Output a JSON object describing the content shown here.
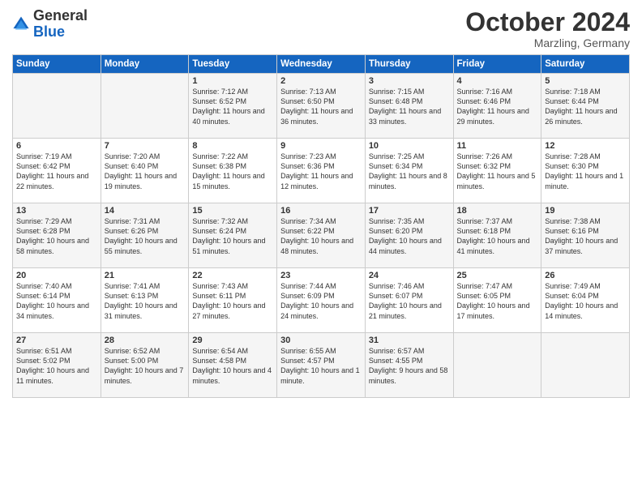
{
  "header": {
    "logo_general": "General",
    "logo_blue": "Blue",
    "month_title": "October 2024",
    "location": "Marzling, Germany"
  },
  "days_of_week": [
    "Sunday",
    "Monday",
    "Tuesday",
    "Wednesday",
    "Thursday",
    "Friday",
    "Saturday"
  ],
  "weeks": [
    [
      {
        "num": "",
        "info": ""
      },
      {
        "num": "",
        "info": ""
      },
      {
        "num": "1",
        "info": "Sunrise: 7:12 AM\nSunset: 6:52 PM\nDaylight: 11 hours and 40 minutes."
      },
      {
        "num": "2",
        "info": "Sunrise: 7:13 AM\nSunset: 6:50 PM\nDaylight: 11 hours and 36 minutes."
      },
      {
        "num": "3",
        "info": "Sunrise: 7:15 AM\nSunset: 6:48 PM\nDaylight: 11 hours and 33 minutes."
      },
      {
        "num": "4",
        "info": "Sunrise: 7:16 AM\nSunset: 6:46 PM\nDaylight: 11 hours and 29 minutes."
      },
      {
        "num": "5",
        "info": "Sunrise: 7:18 AM\nSunset: 6:44 PM\nDaylight: 11 hours and 26 minutes."
      }
    ],
    [
      {
        "num": "6",
        "info": "Sunrise: 7:19 AM\nSunset: 6:42 PM\nDaylight: 11 hours and 22 minutes."
      },
      {
        "num": "7",
        "info": "Sunrise: 7:20 AM\nSunset: 6:40 PM\nDaylight: 11 hours and 19 minutes."
      },
      {
        "num": "8",
        "info": "Sunrise: 7:22 AM\nSunset: 6:38 PM\nDaylight: 11 hours and 15 minutes."
      },
      {
        "num": "9",
        "info": "Sunrise: 7:23 AM\nSunset: 6:36 PM\nDaylight: 11 hours and 12 minutes."
      },
      {
        "num": "10",
        "info": "Sunrise: 7:25 AM\nSunset: 6:34 PM\nDaylight: 11 hours and 8 minutes."
      },
      {
        "num": "11",
        "info": "Sunrise: 7:26 AM\nSunset: 6:32 PM\nDaylight: 11 hours and 5 minutes."
      },
      {
        "num": "12",
        "info": "Sunrise: 7:28 AM\nSunset: 6:30 PM\nDaylight: 11 hours and 1 minute."
      }
    ],
    [
      {
        "num": "13",
        "info": "Sunrise: 7:29 AM\nSunset: 6:28 PM\nDaylight: 10 hours and 58 minutes."
      },
      {
        "num": "14",
        "info": "Sunrise: 7:31 AM\nSunset: 6:26 PM\nDaylight: 10 hours and 55 minutes."
      },
      {
        "num": "15",
        "info": "Sunrise: 7:32 AM\nSunset: 6:24 PM\nDaylight: 10 hours and 51 minutes."
      },
      {
        "num": "16",
        "info": "Sunrise: 7:34 AM\nSunset: 6:22 PM\nDaylight: 10 hours and 48 minutes."
      },
      {
        "num": "17",
        "info": "Sunrise: 7:35 AM\nSunset: 6:20 PM\nDaylight: 10 hours and 44 minutes."
      },
      {
        "num": "18",
        "info": "Sunrise: 7:37 AM\nSunset: 6:18 PM\nDaylight: 10 hours and 41 minutes."
      },
      {
        "num": "19",
        "info": "Sunrise: 7:38 AM\nSunset: 6:16 PM\nDaylight: 10 hours and 37 minutes."
      }
    ],
    [
      {
        "num": "20",
        "info": "Sunrise: 7:40 AM\nSunset: 6:14 PM\nDaylight: 10 hours and 34 minutes."
      },
      {
        "num": "21",
        "info": "Sunrise: 7:41 AM\nSunset: 6:13 PM\nDaylight: 10 hours and 31 minutes."
      },
      {
        "num": "22",
        "info": "Sunrise: 7:43 AM\nSunset: 6:11 PM\nDaylight: 10 hours and 27 minutes."
      },
      {
        "num": "23",
        "info": "Sunrise: 7:44 AM\nSunset: 6:09 PM\nDaylight: 10 hours and 24 minutes."
      },
      {
        "num": "24",
        "info": "Sunrise: 7:46 AM\nSunset: 6:07 PM\nDaylight: 10 hours and 21 minutes."
      },
      {
        "num": "25",
        "info": "Sunrise: 7:47 AM\nSunset: 6:05 PM\nDaylight: 10 hours and 17 minutes."
      },
      {
        "num": "26",
        "info": "Sunrise: 7:49 AM\nSunset: 6:04 PM\nDaylight: 10 hours and 14 minutes."
      }
    ],
    [
      {
        "num": "27",
        "info": "Sunrise: 6:51 AM\nSunset: 5:02 PM\nDaylight: 10 hours and 11 minutes."
      },
      {
        "num": "28",
        "info": "Sunrise: 6:52 AM\nSunset: 5:00 PM\nDaylight: 10 hours and 7 minutes."
      },
      {
        "num": "29",
        "info": "Sunrise: 6:54 AM\nSunset: 4:58 PM\nDaylight: 10 hours and 4 minutes."
      },
      {
        "num": "30",
        "info": "Sunrise: 6:55 AM\nSunset: 4:57 PM\nDaylight: 10 hours and 1 minute."
      },
      {
        "num": "31",
        "info": "Sunrise: 6:57 AM\nSunset: 4:55 PM\nDaylight: 9 hours and 58 minutes."
      },
      {
        "num": "",
        "info": ""
      },
      {
        "num": "",
        "info": ""
      }
    ]
  ]
}
